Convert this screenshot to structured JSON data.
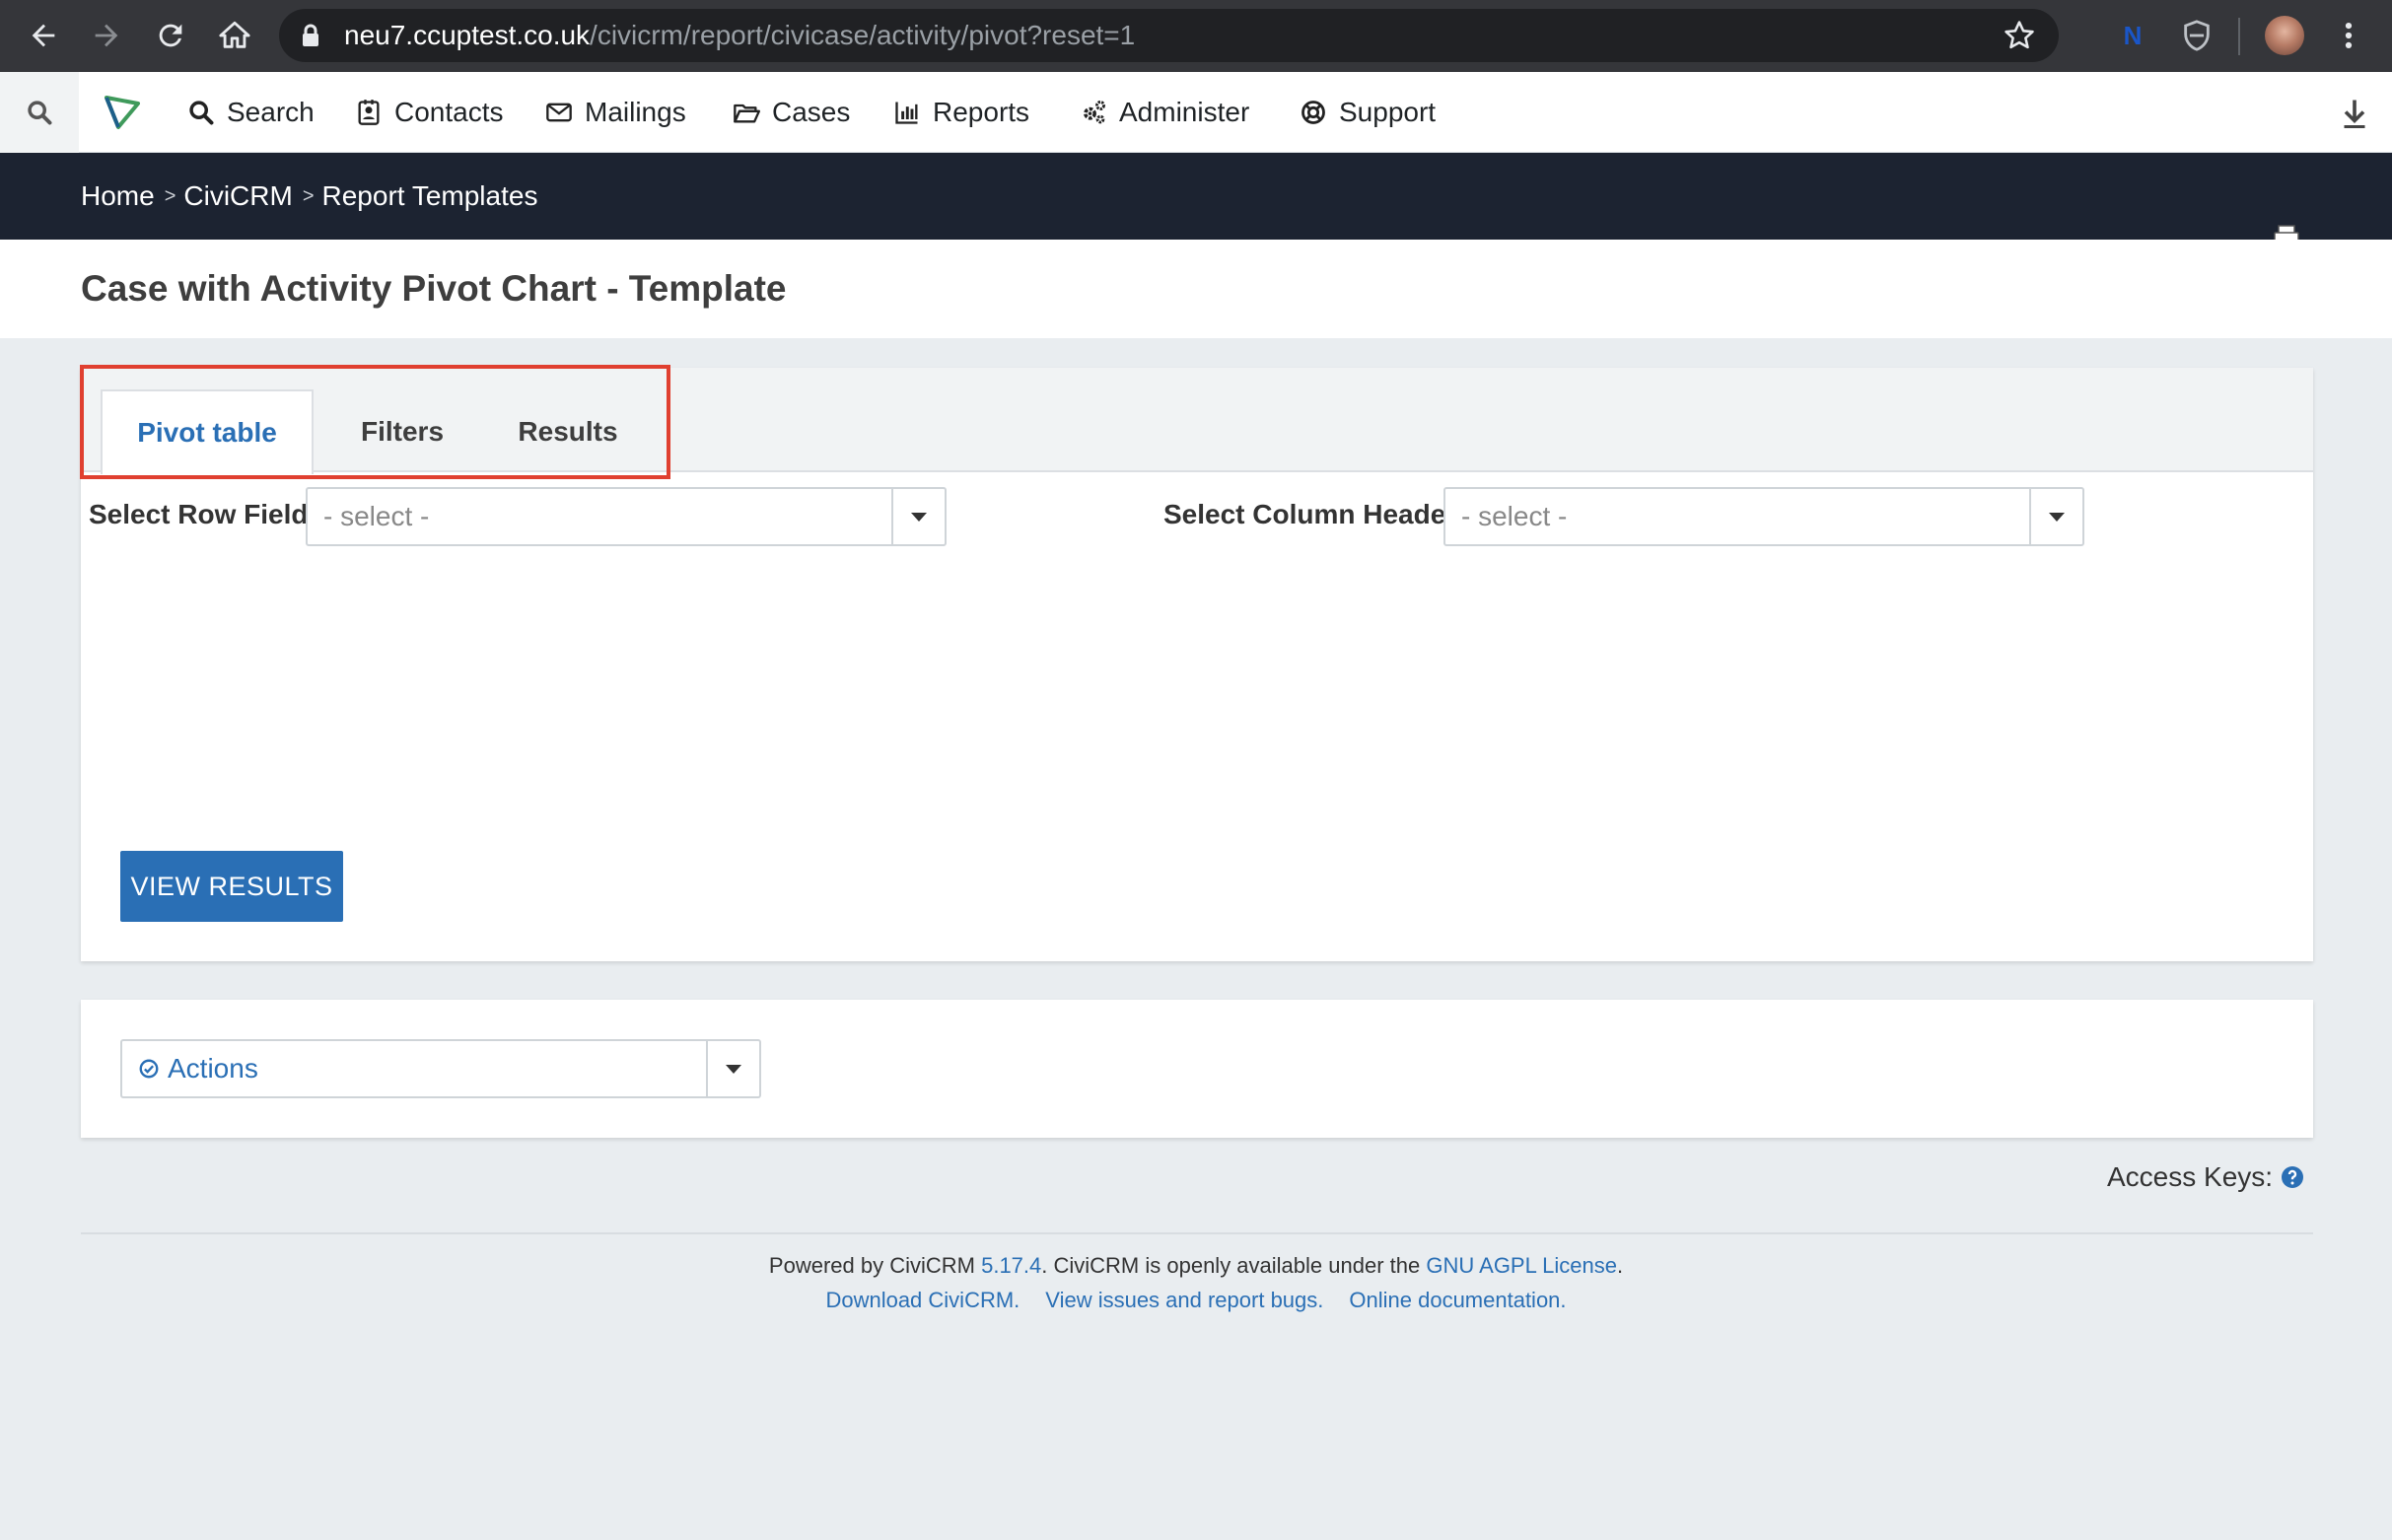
{
  "browser": {
    "url_host": "neu7.ccuptest.co.uk",
    "url_path": "/civicrm/report/civicase/activity/pivot?reset=1",
    "extension_label": "N"
  },
  "menubar": {
    "items": [
      {
        "label": "Search",
        "icon": "search-icon"
      },
      {
        "label": "Contacts",
        "icon": "contact-card-icon"
      },
      {
        "label": "Mailings",
        "icon": "envelope-icon"
      },
      {
        "label": "Cases",
        "icon": "folder-open-icon"
      },
      {
        "label": "Reports",
        "icon": "bar-chart-icon"
      },
      {
        "label": "Administer",
        "icon": "gears-icon"
      },
      {
        "label": "Support",
        "icon": "life-ring-icon"
      }
    ]
  },
  "breadcrumb": [
    "Home",
    "CiviCRM",
    "Report Templates"
  ],
  "breadcrumb_separator": ">",
  "page_title": "Case with Activity Pivot Chart - Template",
  "tabs": [
    "Pivot table",
    "Filters",
    "Results"
  ],
  "active_tab": "Pivot table",
  "pivot": {
    "row_fields_label": "Select Row Fields",
    "row_fields_value": "- select -",
    "column_header_label": "Select Column Header",
    "column_header_value": "- select -",
    "view_results_button": "VIEW RESULTS"
  },
  "actions": {
    "label": "Actions"
  },
  "access_keys": {
    "label": "Access Keys:",
    "icon": "question-circle-icon"
  },
  "footer": {
    "powered_by": "Powered by CiviCRM",
    "version": "5.17.4",
    "available_text": ". CiviCRM is openly available under the",
    "license_link": "GNU AGPL License",
    "period": ".",
    "links": [
      "Download CiviCRM.",
      "View issues and report bugs.",
      "Online documentation."
    ]
  },
  "colors": {
    "accent": "#2a6fb5",
    "breadcrumb_bg": "#1c2331",
    "highlight": "#e04030"
  }
}
